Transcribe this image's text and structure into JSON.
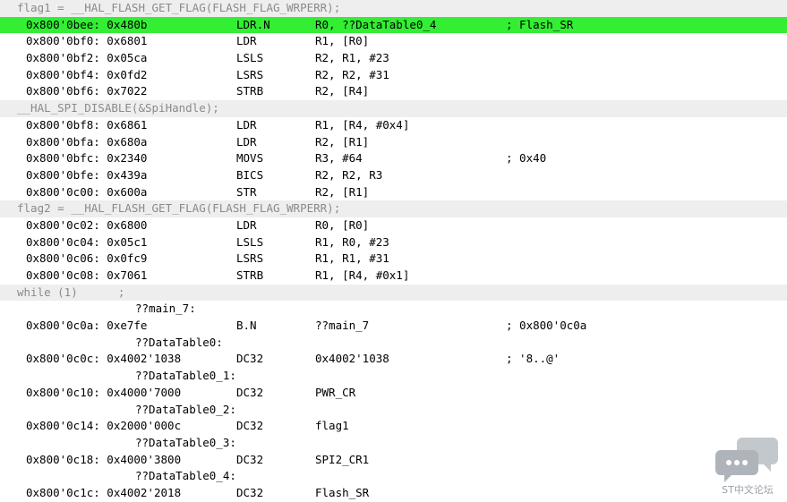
{
  "lines": [
    {
      "kind": "src",
      "text": "flag1 = __HAL_FLASH_GET_FLAG(FLASH_FLAG_WRPERR);"
    },
    {
      "kind": "asm",
      "highlight": true,
      "addr": "0x800'0bee: 0x480b",
      "mnemonic": "LDR.N",
      "operands": "R0, ??DataTable0_4",
      "comment": "; Flash_SR"
    },
    {
      "kind": "asm",
      "addr": "0x800'0bf0: 0x6801",
      "mnemonic": "LDR",
      "operands": "R1, [R0]",
      "comment": ""
    },
    {
      "kind": "asm",
      "addr": "0x800'0bf2: 0x05ca",
      "mnemonic": "LSLS",
      "operands": "R2, R1, #23",
      "comment": ""
    },
    {
      "kind": "asm",
      "addr": "0x800'0bf4: 0x0fd2",
      "mnemonic": "LSRS",
      "operands": "R2, R2, #31",
      "comment": ""
    },
    {
      "kind": "asm",
      "addr": "0x800'0bf6: 0x7022",
      "mnemonic": "STRB",
      "operands": "R2, [R4]",
      "comment": ""
    },
    {
      "kind": "src",
      "text": "__HAL_SPI_DISABLE(&SpiHandle);"
    },
    {
      "kind": "asm",
      "addr": "0x800'0bf8: 0x6861",
      "mnemonic": "LDR",
      "operands": "R1, [R4, #0x4]",
      "comment": ""
    },
    {
      "kind": "asm",
      "addr": "0x800'0bfa: 0x680a",
      "mnemonic": "LDR",
      "operands": "R2, [R1]",
      "comment": ""
    },
    {
      "kind": "asm",
      "addr": "0x800'0bfc: 0x2340",
      "mnemonic": "MOVS",
      "operands": "R3, #64",
      "comment": "; 0x40"
    },
    {
      "kind": "asm",
      "addr": "0x800'0bfe: 0x439a",
      "mnemonic": "BICS",
      "operands": "R2, R2, R3",
      "comment": ""
    },
    {
      "kind": "asm",
      "addr": "0x800'0c00: 0x600a",
      "mnemonic": "STR",
      "operands": "R2, [R1]",
      "comment": ""
    },
    {
      "kind": "src",
      "text": "flag2 = __HAL_FLASH_GET_FLAG(FLASH_FLAG_WRPERR);"
    },
    {
      "kind": "asm",
      "addr": "0x800'0c02: 0x6800",
      "mnemonic": "LDR",
      "operands": "R0, [R0]",
      "comment": ""
    },
    {
      "kind": "asm",
      "addr": "0x800'0c04: 0x05c1",
      "mnemonic": "LSLS",
      "operands": "R1, R0, #23",
      "comment": ""
    },
    {
      "kind": "asm",
      "addr": "0x800'0c06: 0x0fc9",
      "mnemonic": "LSRS",
      "operands": "R1, R1, #31",
      "comment": ""
    },
    {
      "kind": "asm",
      "addr": "0x800'0c08: 0x7061",
      "mnemonic": "STRB",
      "operands": "R1, [R4, #0x1]",
      "comment": ""
    },
    {
      "kind": "src",
      "text": "while (1)      ;"
    },
    {
      "kind": "label",
      "text": "??main_7:"
    },
    {
      "kind": "asm",
      "addr": "0x800'0c0a: 0xe7fe",
      "mnemonic": "B.N",
      "operands": "??main_7",
      "comment": "; 0x800'0c0a"
    },
    {
      "kind": "label",
      "text": "??DataTable0:"
    },
    {
      "kind": "asm",
      "addr": "0x800'0c0c: 0x4002'1038",
      "mnemonic": "DC32",
      "operands": "0x4002'1038",
      "comment": "; '8..@'"
    },
    {
      "kind": "label",
      "text": "??DataTable0_1:"
    },
    {
      "kind": "asm",
      "addr": "0x800'0c10: 0x4000'7000",
      "mnemonic": "DC32",
      "operands": "PWR_CR",
      "comment": ""
    },
    {
      "kind": "label",
      "text": "??DataTable0_2:"
    },
    {
      "kind": "asm",
      "addr": "0x800'0c14: 0x2000'000c",
      "mnemonic": "DC32",
      "operands": "flag1",
      "comment": ""
    },
    {
      "kind": "label",
      "text": "??DataTable0_3:"
    },
    {
      "kind": "asm",
      "addr": "0x800'0c18: 0x4000'3800",
      "mnemonic": "DC32",
      "operands": "SPI2_CR1",
      "comment": ""
    },
    {
      "kind": "label",
      "text": "??DataTable0_4:"
    },
    {
      "kind": "asm",
      "addr": "0x800'0c1c: 0x4002'2018",
      "mnemonic": "DC32",
      "operands": "Flash_SR",
      "comment": ""
    }
  ],
  "watermark": {
    "text": "ST中文论坛",
    "icon": "chat-bubbles-icon"
  },
  "colors": {
    "highlight": "#33ee33",
    "source_bg": "#eeeeee",
    "source_text": "#8a8a8a",
    "logo": "#aeb4ba"
  }
}
